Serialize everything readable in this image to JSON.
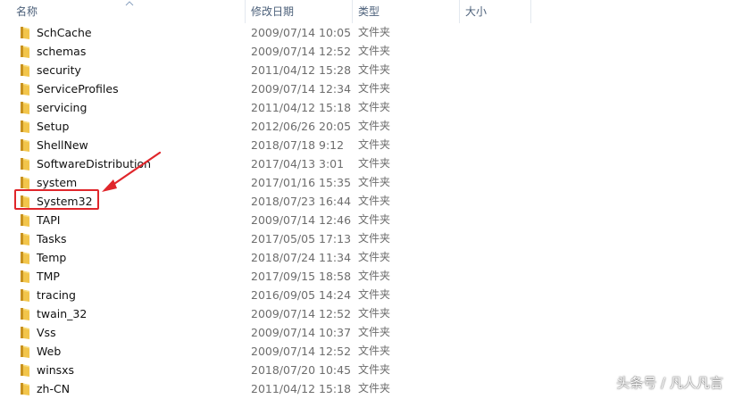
{
  "columns": {
    "name": "名称",
    "date": "修改日期",
    "type": "类型",
    "size": "大小"
  },
  "rows": [
    {
      "name": "SchCache",
      "date": "2009/07/14 10:05",
      "type": "文件夹"
    },
    {
      "name": "schemas",
      "date": "2009/07/14 12:52",
      "type": "文件夹"
    },
    {
      "name": "security",
      "date": "2011/04/12 15:28",
      "type": "文件夹"
    },
    {
      "name": "ServiceProfiles",
      "date": "2009/07/14 12:34",
      "type": "文件夹"
    },
    {
      "name": "servicing",
      "date": "2011/04/12 15:18",
      "type": "文件夹"
    },
    {
      "name": "Setup",
      "date": "2012/06/26 20:05",
      "type": "文件夹"
    },
    {
      "name": "ShellNew",
      "date": "2018/07/18 9:12",
      "type": "文件夹"
    },
    {
      "name": "SoftwareDistribution",
      "date": "2017/04/13 3:01",
      "type": "文件夹"
    },
    {
      "name": "system",
      "date": "2017/01/16 15:35",
      "type": "文件夹"
    },
    {
      "name": "System32",
      "date": "2018/07/23 16:44",
      "type": "文件夹"
    },
    {
      "name": "TAPI",
      "date": "2009/07/14 12:46",
      "type": "文件夹"
    },
    {
      "name": "Tasks",
      "date": "2017/05/05 17:13",
      "type": "文件夹"
    },
    {
      "name": "Temp",
      "date": "2018/07/24 11:34",
      "type": "文件夹"
    },
    {
      "name": "TMP",
      "date": "2017/09/15 18:58",
      "type": "文件夹"
    },
    {
      "name": "tracing",
      "date": "2016/09/05 14:24",
      "type": "文件夹"
    },
    {
      "name": "twain_32",
      "date": "2009/07/14 12:52",
      "type": "文件夹"
    },
    {
      "name": "Vss",
      "date": "2009/07/14 10:37",
      "type": "文件夹"
    },
    {
      "name": "Web",
      "date": "2009/07/14 12:52",
      "type": "文件夹"
    },
    {
      "name": "winsxs",
      "date": "2018/07/20 10:45",
      "type": "文件夹"
    },
    {
      "name": "zh-CN",
      "date": "2011/04/12 15:18",
      "type": "文件夹"
    }
  ],
  "highlighted_item": "System32",
  "watermark": "头条号 / 凡人凡言",
  "colors": {
    "highlight": "#e0262b",
    "folder": "#e8b83a",
    "header_text": "#4c607a",
    "date_text": "#6d6d6d"
  },
  "icons": {
    "folder": "folder-icon",
    "sort": "sort-ascending-icon",
    "arrow": "red-arrow-icon"
  }
}
